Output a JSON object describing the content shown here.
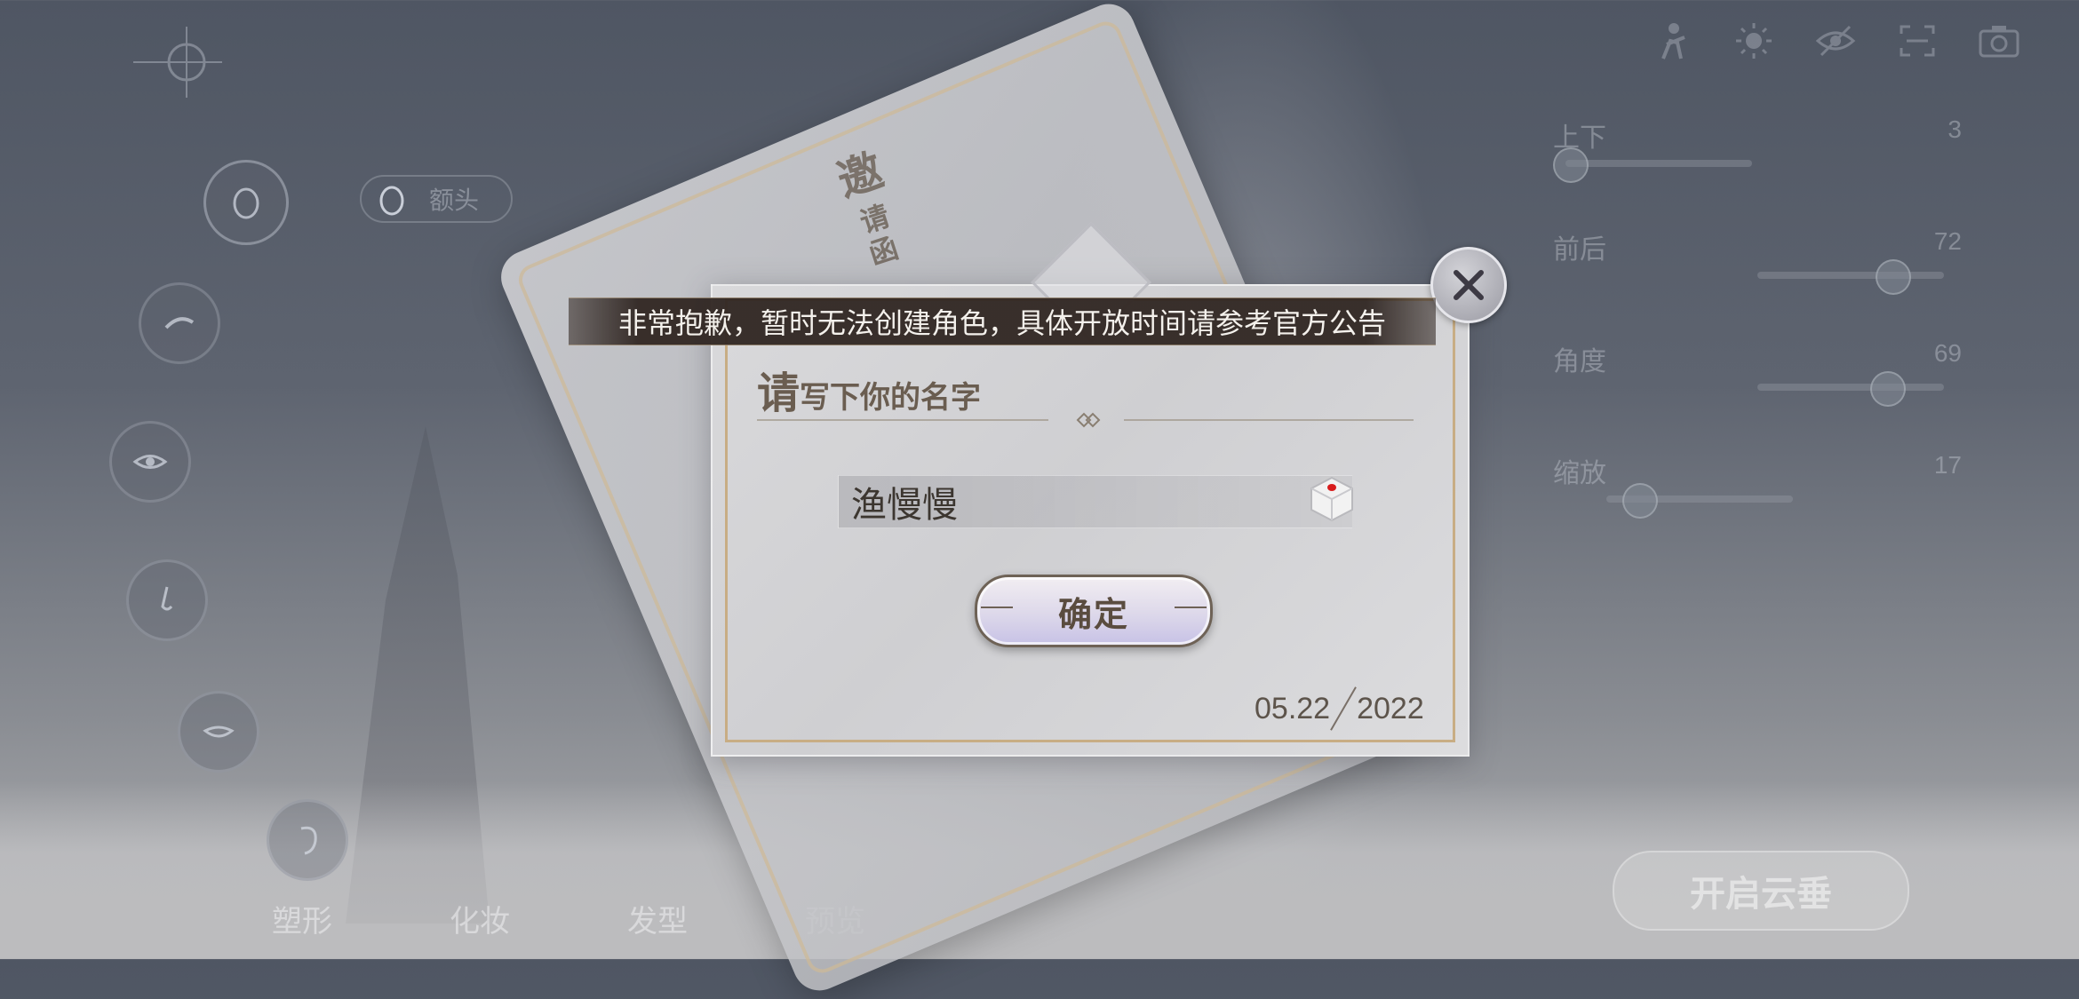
{
  "top_icons": [
    "figure-icon",
    "sun-icon",
    "eye-hide-icon",
    "fullscreen-icon",
    "camera-icon"
  ],
  "left_panel": {
    "part_label": "额头"
  },
  "sliders": [
    {
      "label": "上下",
      "value": "3",
      "level": 0.02
    },
    {
      "label": "前后",
      "value": "72",
      "level": 0.72
    },
    {
      "label": "角度",
      "value": "69",
      "level": 0.69
    },
    {
      "label": "缩放",
      "value": "17",
      "level": 0.17
    }
  ],
  "bottom_tabs": [
    "塑形",
    "化妆",
    "发型",
    "预览"
  ],
  "enter_button": "开启云垂",
  "envelope": {
    "title_big": "邀",
    "title_small1": "请",
    "title_small2": "函"
  },
  "dialog": {
    "heading_big": "请",
    "heading_rest": "写下你的名字",
    "name_value": "渔慢慢",
    "confirm_label": "确定",
    "date_left": "05.22",
    "date_right": "2022"
  },
  "toast": {
    "message": "非常抱歉，暂时无法创建角色，具体开放时间请参考官方公告"
  }
}
